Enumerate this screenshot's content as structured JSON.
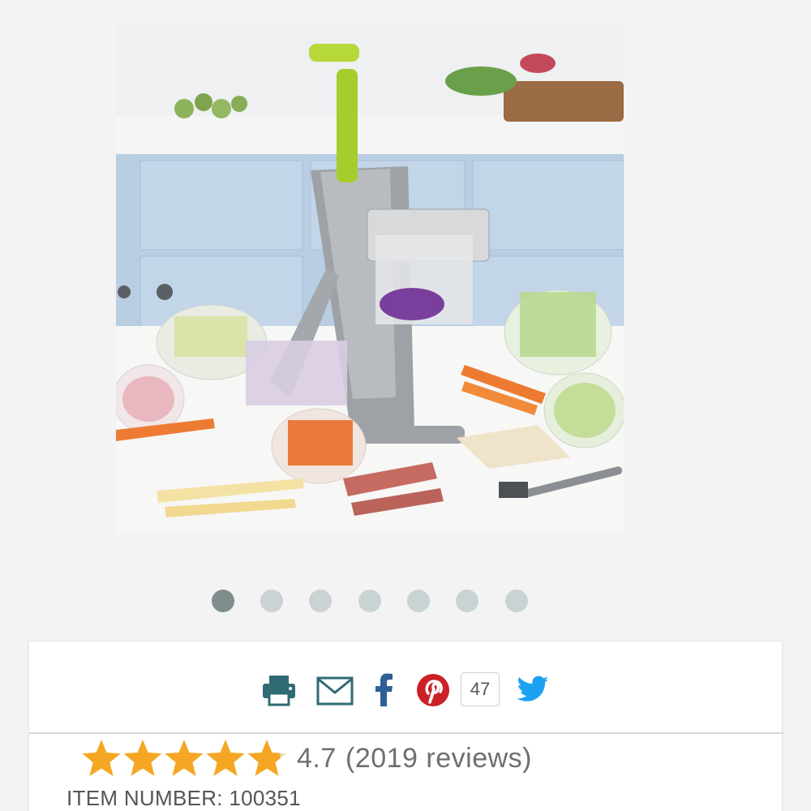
{
  "product": {
    "image_alt": "Spiralizer slicer with cut vegetables"
  },
  "carousel": {
    "dots": [
      {
        "active": true
      },
      {
        "active": false
      },
      {
        "active": false
      },
      {
        "active": false
      },
      {
        "active": false
      },
      {
        "active": false
      },
      {
        "active": false
      }
    ]
  },
  "share": {
    "icons": [
      "print-icon",
      "email-icon",
      "facebook-icon",
      "pinterest-icon",
      "twitter-icon"
    ],
    "pinterest_count": "47",
    "colors": {
      "print": "#2f6b74",
      "email": "#2f6b74",
      "facebook": "#2f5f97",
      "pinterest": "#cb2027",
      "twitter": "#1da1f2"
    }
  },
  "rating": {
    "value": "4.7",
    "count_text": "(2019 reviews)",
    "stars": 5,
    "star_color": "#f5a623"
  },
  "item": {
    "label": "ITEM NUMBER:",
    "number": "100351"
  }
}
